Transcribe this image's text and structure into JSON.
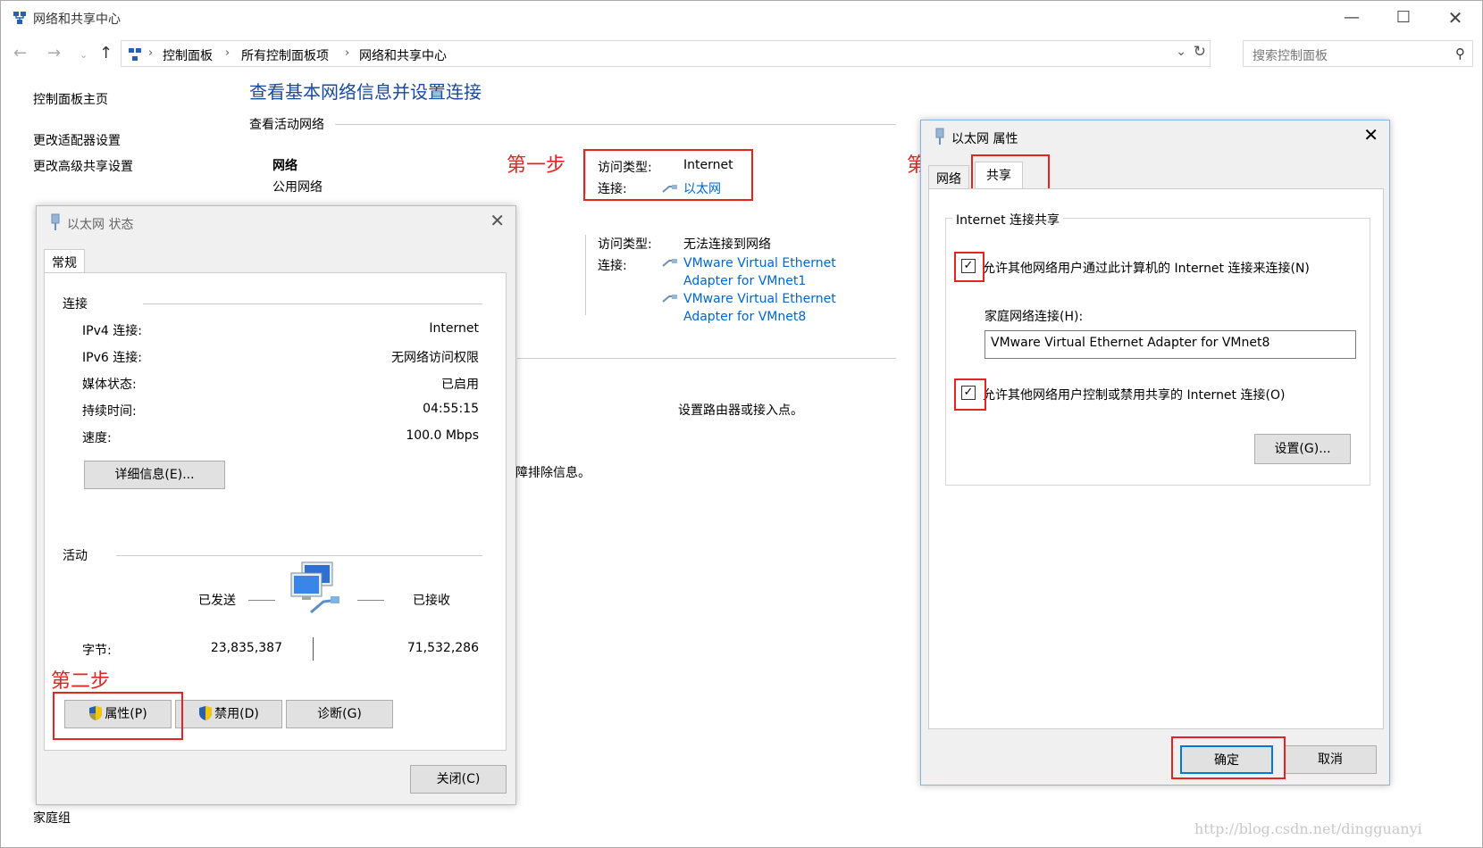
{
  "window": {
    "title": "网络和共享中心",
    "minimize": "—",
    "maximize": "☐",
    "close": "✕"
  },
  "nav": {
    "back": "←",
    "forward": "→",
    "recent": "⌄",
    "up": "↑",
    "dropdown": "⌄",
    "refresh": "↻"
  },
  "breadcrumb": [
    "控制面板",
    "所有控制面板项",
    "网络和共享中心"
  ],
  "search": {
    "placeholder": "搜索控制面板",
    "icon": "⚲"
  },
  "sidebar": {
    "items": [
      {
        "label": "控制面板主页"
      },
      {
        "label": "更改适配器设置"
      },
      {
        "label": "更改高级共享设置"
      }
    ],
    "bottom_items": [
      {
        "label": "家庭组"
      }
    ]
  },
  "main": {
    "title": "查看基本网络信息并设置连接",
    "active_networks_heading": "查看活动网络",
    "network1": {
      "name": "网络",
      "category": "公用网络",
      "access_label": "访问类型:",
      "access_value": "Internet",
      "connection_label": "连接:",
      "connection_value": "以太网"
    },
    "network2": {
      "access_label": "访问类型:",
      "access_value": "无法连接到网络",
      "connection_label": "连接:",
      "connections": [
        {
          "line1": "VMware Virtual Ethernet",
          "line2": "Adapter for VMnet1"
        },
        {
          "line1": "VMware Virtual Ethernet",
          "line2": "Adapter for VMnet8"
        }
      ]
    },
    "partial_text1": "设置路由器或接入点。",
    "partial_text2": "诊断和修复网络问题，或者获得故障排除信息。"
  },
  "annotations": {
    "step1": "第一步",
    "step2": "第二步",
    "step3": "第三步"
  },
  "status_dialog": {
    "title": "以太网 状态",
    "close": "✕",
    "tab_general": "常规",
    "connection_heading": "连接",
    "rows": [
      {
        "label": "IPv4 连接:",
        "value": "Internet"
      },
      {
        "label": "IPv6 连接:",
        "value": "无网络访问权限"
      },
      {
        "label": "媒体状态:",
        "value": "已启用"
      },
      {
        "label": "持续时间:",
        "value": "04:55:15"
      },
      {
        "label": "速度:",
        "value": "100.0 Mbps"
      }
    ],
    "details_button": "详细信息(E)...",
    "activity_heading": "活动",
    "sent_label": "已发送",
    "received_label": "已接收",
    "bytes_label": "字节:",
    "bytes_sent": "23,835,387",
    "bytes_received": "71,532,286",
    "properties_button": "属性(P)",
    "disable_button": "禁用(D)",
    "diagnose_button": "诊断(G)",
    "close_button": "关闭(C)"
  },
  "props_dialog": {
    "title": "以太网 属性",
    "close": "✕",
    "tab_network": "网络",
    "tab_sharing": "共享",
    "group_title": "Internet 连接共享",
    "allow_connect": {
      "label": "允许其他网络用户通过此计算机的 Internet 连接来连接(N)",
      "checked": true,
      "mark": "✓"
    },
    "home_network_label": "家庭网络连接(H):",
    "home_network_value": "VMware Virtual Ethernet Adapter for VMnet8",
    "allow_control": {
      "label": "允许其他网络用户控制或禁用共享的 Internet 连接(O)",
      "checked": true,
      "mark": "✓"
    },
    "settings_button": "设置(G)...",
    "ok_button": "确定",
    "cancel_button": "取消"
  },
  "watermark": "http://blog.csdn.net/dingguanyi",
  "colors": {
    "link": "#0066cc",
    "annotation": "#e52421",
    "title_blue": "#1a4a9a"
  }
}
